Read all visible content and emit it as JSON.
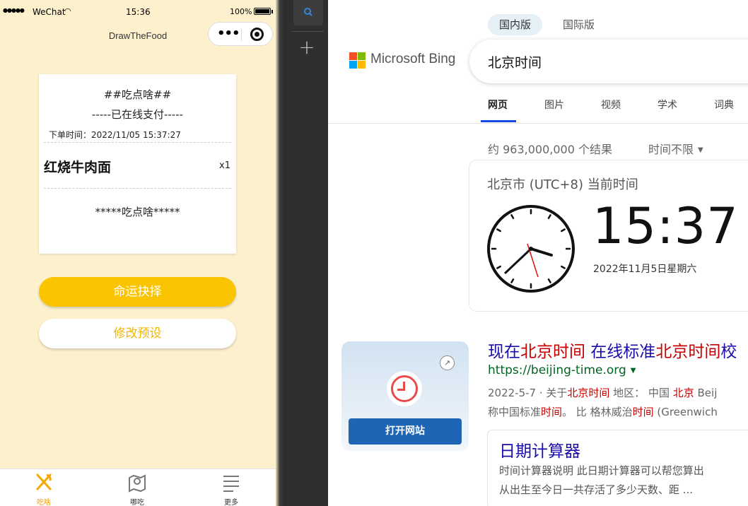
{
  "phone": {
    "status": {
      "carrier": "WeChat",
      "time": "15:36",
      "battery": "100%"
    },
    "nav_title": "DrawTheFood",
    "receipt": {
      "title": "##吃点啥##",
      "paid": "-----已在线支付-----",
      "order_time": "下单时间：2022/11/05 15:37:27",
      "item": "红烧牛肉面",
      "qty": "x1",
      "footer": "*****吃点啥*****"
    },
    "primary_button": "命运抉择",
    "secondary_button": "修改预设",
    "tabs": [
      {
        "label": "吃啥",
        "active": true
      },
      {
        "label": "哪吃",
        "active": false
      },
      {
        "label": "更多",
        "active": false
      }
    ]
  },
  "bing": {
    "region_tabs": [
      "国内版",
      "国际版"
    ],
    "logo_text": "Microsoft Bing",
    "search_query": "北京时间",
    "scope_tabs": [
      "网页",
      "图片",
      "视频",
      "学术",
      "词典"
    ],
    "result_count": "约 963,000,000 个结果",
    "time_filter": "时间不限",
    "clock_card": {
      "city": "北京市 (UTC+8) 当前时间",
      "time": "15:37",
      "date": "2022年11月5日星期六"
    },
    "result1": {
      "title_parts": [
        "现在",
        "北京时间",
        " 在线标准",
        "北京时间",
        "校"
      ],
      "url": "https://beijing-time.org",
      "snippet_line1_parts": [
        "2022-5-7 · 关于",
        "北京时间",
        " 地区： 中国 ",
        "北京",
        " Beij"
      ],
      "snippet_line2_parts": [
        "称中国标准",
        "时间",
        "。 比 格林威治",
        "时间",
        " (Greenwich"
      ],
      "open_button": "打开网站"
    },
    "result2": {
      "title": "日期计算器",
      "line1": "时间计算器说明 此日期计算器可以帮您算出",
      "line2": "从出生至今日一共存活了多少天数、距 ..."
    }
  },
  "colors": {
    "accent_yellow": "#fbc400",
    "phone_bg": "#fdf1cd",
    "bing_link": "#1a0dab",
    "bing_highlight": "#c80000",
    "bing_url": "#006621"
  }
}
